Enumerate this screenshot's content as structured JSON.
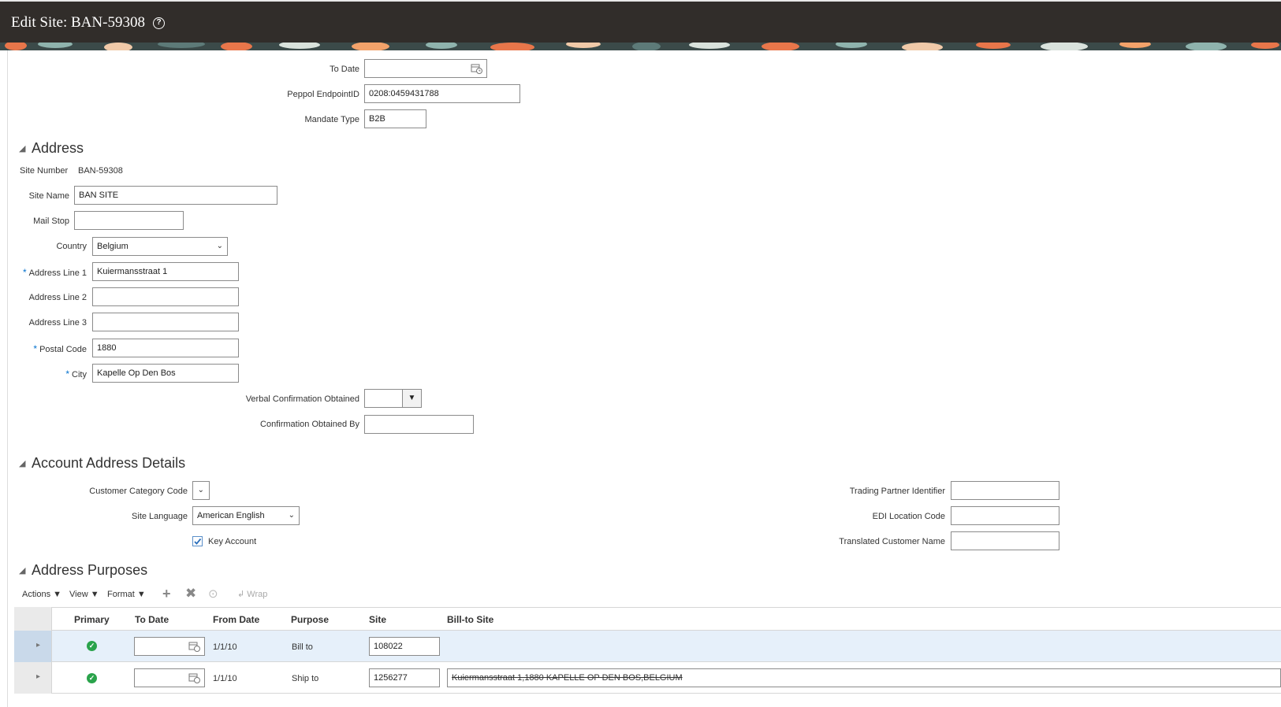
{
  "header": {
    "title": "Edit Site: BAN-59308",
    "help_icon": "question-circle-icon"
  },
  "top_fields": {
    "to_date_label": "To Date",
    "to_date_value": "",
    "peppol_label": "Peppol EndpointID",
    "peppol_value": "0208:0459431788",
    "mandate_label": "Mandate Type",
    "mandate_value": "B2B"
  },
  "address": {
    "section_title": "Address",
    "site_number_label": "Site Number",
    "site_number_value": "BAN-59308",
    "site_name_label": "Site Name",
    "site_name_value": "BAN SITE",
    "mail_stop_label": "Mail Stop",
    "mail_stop_value": "",
    "country_label": "Country",
    "country_value": "Belgium",
    "address1_label": "Address Line 1",
    "address1_value": "Kuiermansstraat 1",
    "address2_label": "Address Line 2",
    "address2_value": "",
    "address3_label": "Address Line 3",
    "address3_value": "",
    "postal_label": "Postal Code",
    "postal_value": "1880",
    "city_label": "City",
    "city_value": "Kapelle Op Den Bos",
    "verbal_label": "Verbal Confirmation Obtained",
    "verbal_value": "",
    "confirmed_by_label": "Confirmation Obtained By",
    "confirmed_by_value": "",
    "required_marker": "*"
  },
  "account_details": {
    "section_title": "Account Address Details",
    "category_label": "Customer Category Code",
    "category_value": "",
    "language_label": "Site Language",
    "language_value": "American English",
    "key_account_label": "Key Account",
    "key_account_checked": true,
    "tpi_label": "Trading Partner Identifier",
    "tpi_value": "",
    "edi_label": "EDI Location Code",
    "edi_value": "",
    "translated_label": "Translated Customer Name",
    "translated_value": ""
  },
  "purposes": {
    "section_title": "Address Purposes",
    "toolbar": {
      "actions": "Actions",
      "view": "View",
      "format": "Format",
      "wrap": "Wrap"
    },
    "columns": [
      "Primary",
      "To Date",
      "From Date",
      "Purpose",
      "Site",
      "Bill-to Site"
    ],
    "rows": [
      {
        "primary": true,
        "to_date": "",
        "from_date": "1/1/10",
        "purpose": "Bill to",
        "site": "108022",
        "bill_to": ""
      },
      {
        "primary": true,
        "to_date": "",
        "from_date": "1/1/10",
        "purpose": "Ship to",
        "site": "1256277",
        "bill_to": "Kuiermansstraat 1,1880 KAPELLE OP DEN BOS,BELGIUM"
      }
    ]
  }
}
